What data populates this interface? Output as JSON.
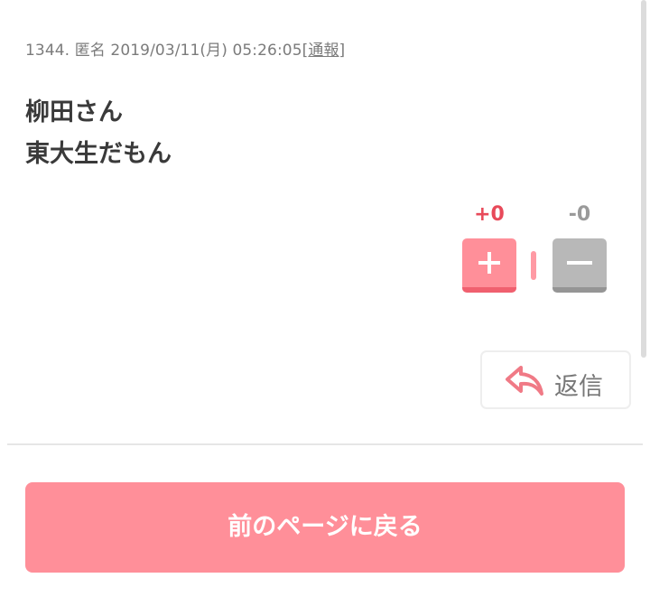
{
  "post": {
    "number": "1344.",
    "author": "匿名",
    "datetime": "2019/03/11(月) 05:26:05",
    "report_open": "[",
    "report_label": "通報",
    "report_close": "]",
    "body_line1": "柳田さん",
    "body_line2": "東大生だもん"
  },
  "votes": {
    "plus_count": "+0",
    "minus_count": "-0",
    "plus_icon": "plus-icon",
    "minus_icon": "minus-icon"
  },
  "reply": {
    "label": "返信",
    "icon": "reply-arrow-icon"
  },
  "navigation": {
    "back_label": "前のページに戻る"
  },
  "colors": {
    "accent": "#ff8f99",
    "plus_text": "#e84a5a",
    "minus_button": "#b8b8b8"
  }
}
